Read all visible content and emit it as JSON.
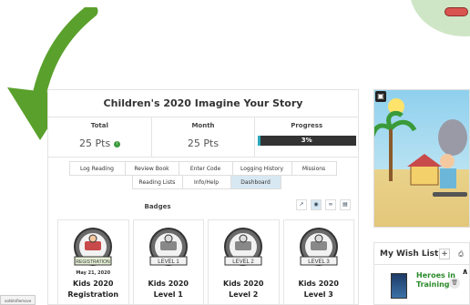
{
  "panel": {
    "title": "Children's 2020 Imagine Your Story"
  },
  "stats": {
    "total_label": "Total",
    "total_value": "25 Pts",
    "month_label": "Month",
    "month_value": "25 Pts",
    "progress_label": "Progress",
    "progress_text": "3%",
    "progress_percent": 3,
    "progress_color": "#2aa7b8"
  },
  "nav": {
    "row1": [
      "Log Reading",
      "Review Book",
      "Enter Code",
      "Logging History",
      "Missions"
    ],
    "row2": [
      "Reading Lists",
      "Info/Help",
      "Dashboard"
    ],
    "active": "Dashboard"
  },
  "badges": {
    "title": "Badges",
    "tool_icons": [
      "chart-icon",
      "badge-icon",
      "infinity-icon",
      "map-icon"
    ],
    "items": [
      {
        "label": "REGISTRATION",
        "date": "May 21, 2020",
        "name": "Kids 2020",
        "name2": "Registration",
        "color": "#c94a4a"
      },
      {
        "label": "LEVEL 1",
        "date": "",
        "name": "Kids 2020",
        "name2": "Level 1",
        "color": "#777777"
      },
      {
        "label": "LEVEL 2",
        "date": "",
        "name": "Kids 2020",
        "name2": "Level 2",
        "color": "#777777"
      },
      {
        "label": "LEVEL 3",
        "date": "",
        "name": "Kids 2020",
        "name2": "Level 3",
        "color": "#777777"
      }
    ]
  },
  "status_tip": "ootbtnRemove",
  "wishlist": {
    "title": "My Wish List",
    "add_label": "+",
    "book_title": "Heroes in Training"
  },
  "colors": {
    "arrow": "#5aa02c",
    "accent": "#d8e8f2"
  }
}
